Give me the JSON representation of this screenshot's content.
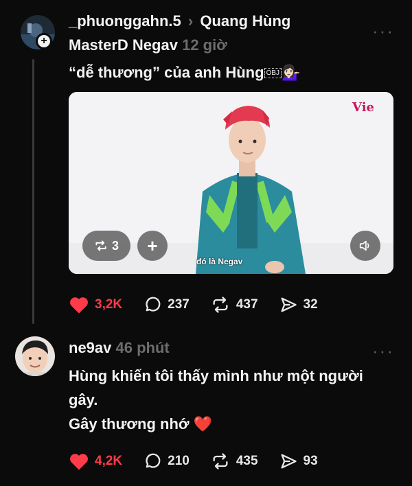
{
  "post1": {
    "username": "_phuonggahn.5",
    "reply_to": "Quang Hùng",
    "reply_to_2": "MasterD Negav",
    "time": "12 giờ",
    "text": "“dễ thương” của anh Hùng",
    "obj_glyph": "OBJ",
    "emoji": "💁🏻‍♀️",
    "media": {
      "watermark": "Vie",
      "caption": "đó là Negav",
      "repost_count": "3"
    },
    "stats": {
      "likes": "3,2K",
      "comments": "237",
      "reposts": "437",
      "shares": "32"
    }
  },
  "post2": {
    "username": "ne9av",
    "time": "46 phút",
    "line1": "Hùng khiến tôi thấy mình như một người",
    "line2": "gây.",
    "line3": "Gây thương nhớ",
    "emoji": "❤️",
    "stats": {
      "likes": "4,2K",
      "comments": "210",
      "reposts": "435",
      "shares": "93"
    }
  },
  "colors": {
    "background": "#0b0b0b",
    "like_red": "#ff3b4a",
    "muted": "#6d6d6d"
  },
  "icons": [
    "heart-icon",
    "comment-icon",
    "repost-icon",
    "share-icon",
    "more-icon",
    "plus-icon",
    "volume-icon"
  ]
}
